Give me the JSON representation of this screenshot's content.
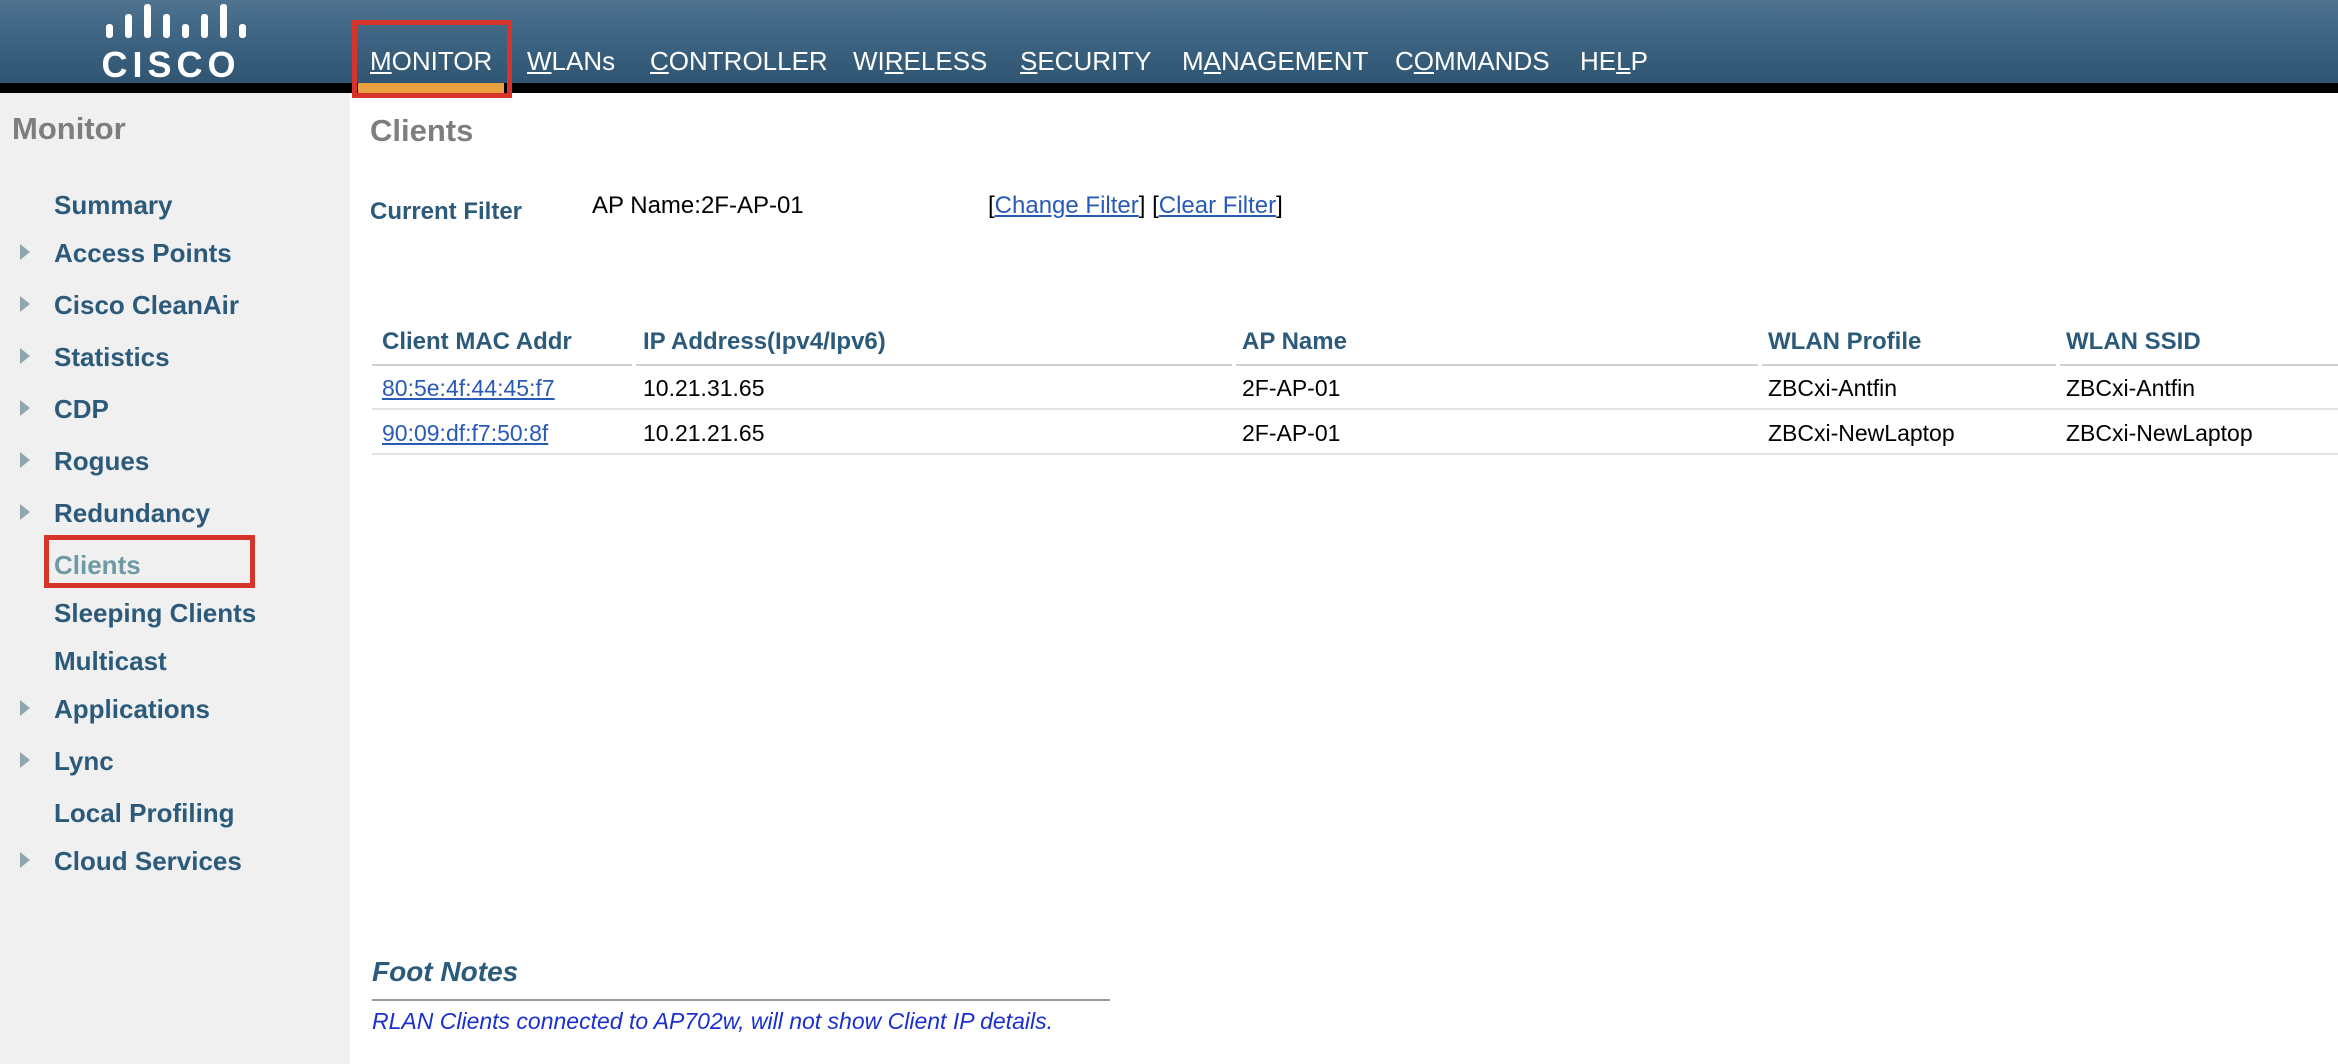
{
  "header": {
    "logo_text": "CISCO",
    "nav": [
      {
        "pre": "",
        "u": "M",
        "post": "ONITOR"
      },
      {
        "pre": "",
        "u": "W",
        "post": "LANs"
      },
      {
        "pre": "",
        "u": "C",
        "post": "ONTROLLER"
      },
      {
        "pre": "WI",
        "u": "R",
        "post": "ELESS"
      },
      {
        "pre": "",
        "u": "S",
        "post": "ECURITY"
      },
      {
        "pre": "M",
        "u": "A",
        "post": "NAGEMENT"
      },
      {
        "pre": "C",
        "u": "O",
        "post": "MMANDS"
      },
      {
        "pre": "HE",
        "u": "L",
        "post": "P"
      }
    ],
    "active_nav": "MONITOR"
  },
  "sidebar": {
    "title": "Monitor",
    "items": [
      {
        "label": "Summary",
        "expandable": false
      },
      {
        "label": "Access Points",
        "expandable": true
      },
      {
        "label": "Cisco CleanAir",
        "expandable": true
      },
      {
        "label": "Statistics",
        "expandable": true
      },
      {
        "label": "CDP",
        "expandable": true
      },
      {
        "label": "Rogues",
        "expandable": true
      },
      {
        "label": "Redundancy",
        "expandable": true
      },
      {
        "label": "Clients",
        "expandable": false,
        "active": true
      },
      {
        "label": "Sleeping Clients",
        "expandable": false
      },
      {
        "label": "Multicast",
        "expandable": false
      },
      {
        "label": "Applications",
        "expandable": true
      },
      {
        "label": "Lync",
        "expandable": true
      },
      {
        "label": "Local Profiling",
        "expandable": false
      },
      {
        "label": "Cloud Services",
        "expandable": true
      }
    ]
  },
  "main": {
    "title": "Clients",
    "filter": {
      "label": "Current Filter",
      "value": "AP Name:2F-AP-01",
      "change_link": "Change Filter",
      "clear_link": "Clear Filter"
    },
    "table": {
      "columns": [
        "Client MAC Addr",
        "IP Address(Ipv4/Ipv6)",
        "AP Name",
        "WLAN Profile",
        "WLAN SSID"
      ],
      "rows": [
        [
          "80:5e:4f:44:45:f7",
          "10.21.31.65",
          "2F-AP-01",
          "ZBCxi-Antfin",
          "ZBCxi-Antfin"
        ],
        [
          "90:09:df:f7:50:8f",
          "10.21.21.65",
          "2F-AP-01",
          "ZBCxi-NewLaptop",
          "ZBCxi-NewLaptop"
        ]
      ]
    },
    "footnotes": {
      "title": "Foot Notes",
      "note": "RLAN Clients connected to AP702w, will not show Client IP details."
    }
  },
  "colors": {
    "header": "#3d6482",
    "link": "#2a5ab8",
    "heading": "#2c5a7b",
    "highlight_box": "#d6342a",
    "active_underline": "#e8a040"
  }
}
